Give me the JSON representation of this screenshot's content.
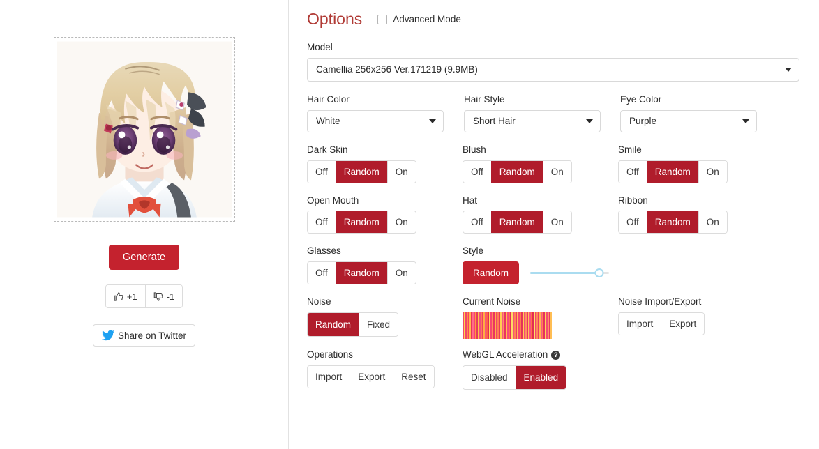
{
  "left": {
    "portrait_alt": "generated-anime-face",
    "generate_label": "Generate",
    "vote_up_label": "+1",
    "vote_down_label": "-1",
    "twitter_label": "Share on Twitter"
  },
  "options": {
    "title": "Options",
    "advanced_mode_label": "Advanced Mode",
    "advanced_mode_checked": false,
    "model": {
      "label": "Model",
      "value": "Camellia 256x256 Ver.171219 (9.9MB)"
    },
    "selects": [
      {
        "label": "Hair Color",
        "value": "White"
      },
      {
        "label": "Hair Style",
        "value": "Short Hair"
      },
      {
        "label": "Eye Color",
        "value": "Purple"
      }
    ],
    "toggles": [
      {
        "label": "Dark Skin",
        "options": [
          "Off",
          "Random",
          "On"
        ],
        "selected": "Random"
      },
      {
        "label": "Blush",
        "options": [
          "Off",
          "Random",
          "On"
        ],
        "selected": "Random"
      },
      {
        "label": "Smile",
        "options": [
          "Off",
          "Random",
          "On"
        ],
        "selected": "Random"
      },
      {
        "label": "Open Mouth",
        "options": [
          "Off",
          "Random",
          "On"
        ],
        "selected": "Random"
      },
      {
        "label": "Hat",
        "options": [
          "Off",
          "Random",
          "On"
        ],
        "selected": "Random"
      },
      {
        "label": "Ribbon",
        "options": [
          "Off",
          "Random",
          "On"
        ],
        "selected": "Random"
      },
      {
        "label": "Glasses",
        "options": [
          "Off",
          "Random",
          "On"
        ],
        "selected": "Random"
      }
    ],
    "style": {
      "label": "Style",
      "random_label": "Random",
      "slider_value": 88
    },
    "noise": {
      "label": "Noise",
      "options": [
        "Random",
        "Fixed"
      ],
      "selected": "Random"
    },
    "current_noise": {
      "label": "Current Noise"
    },
    "noise_io": {
      "label": "Noise Import/Export",
      "buttons": [
        "Import",
        "Export"
      ]
    },
    "operations": {
      "label": "Operations",
      "buttons": [
        "Import",
        "Export",
        "Reset"
      ]
    },
    "webgl": {
      "label": "WebGL Acceleration",
      "help_glyph": "?",
      "options": [
        "Disabled",
        "Enabled"
      ],
      "selected": "Enabled"
    }
  },
  "colors": {
    "accent_red": "#b01c2b",
    "button_red": "#c4222e",
    "title_red": "#b03a35",
    "twitter_blue": "#1da1f2",
    "slider_blue": "#aadcf0"
  },
  "noise_stripes": [
    "#f5486b",
    "#ffd34d",
    "#f0466a",
    "#ff8a4a",
    "#fa3f62",
    "#ffb84d",
    "#e8345c",
    "#ff6b8a",
    "#f9456d",
    "#ff9a3d",
    "#e53a5e",
    "#ffc64a",
    "#f0527b",
    "#ff7a55",
    "#ed3f66",
    "#ffae42",
    "#f4577e",
    "#ff6347",
    "#e12d55",
    "#ffd95c",
    "#f7486f",
    "#ff8c5a",
    "#ea3560",
    "#ffb347",
    "#f1456c",
    "#ff7f50",
    "#e63a5b",
    "#ffce52",
    "#f55a80",
    "#ff9166",
    "#e9345f",
    "#ffc14d",
    "#f8497a",
    "#ff6f4f",
    "#e32f58",
    "#ffdb63",
    "#f3527c",
    "#ff8452",
    "#ee3b63",
    "#ffb957",
    "#f6466f",
    "#ff7b4d",
    "#e4335a",
    "#ffd14f",
    "#f24e78",
    "#ff8f5e",
    "#eb3862",
    "#ffc35a",
    "#f9527f",
    "#ff7448",
    "#e22c54",
    "#ffe066",
    "#f04571",
    "#ff8859",
    "#ec3a65",
    "#ffb64f",
    "#f75c82",
    "#ff7e52",
    "#e5315d",
    "#ffd457",
    "#f34a74",
    "#ff9462",
    "#e93663",
    "#ffbe54"
  ]
}
